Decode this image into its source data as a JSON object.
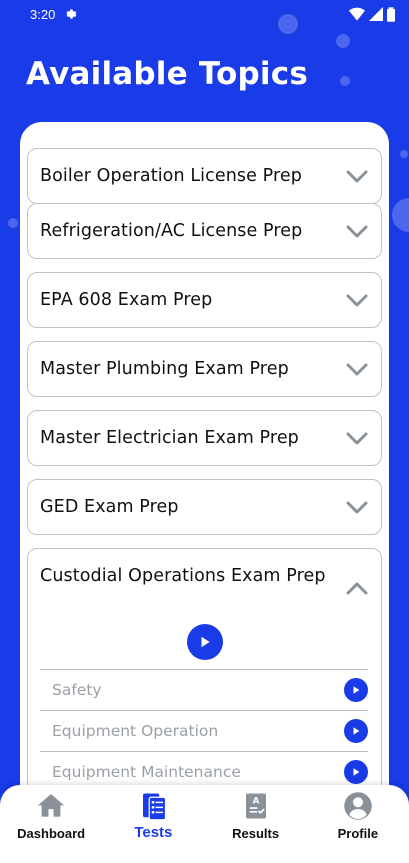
{
  "status_bar": {
    "time": "3:20"
  },
  "header": {
    "title": "Available Topics"
  },
  "topics": [
    {
      "label": "Boiler Operation License Prep",
      "expanded": false
    },
    {
      "label": "Refrigeration/AC License Prep",
      "expanded": false
    },
    {
      "label": "EPA 608 Exam Prep",
      "expanded": false
    },
    {
      "label": "Master Plumbing Exam Prep",
      "expanded": false
    },
    {
      "label": "Master Electrician Exam Prep",
      "expanded": false
    },
    {
      "label": "GED Exam Prep",
      "expanded": false
    },
    {
      "label": "Custodial Operations Exam Prep",
      "expanded": true,
      "subtopics": [
        "Safety",
        "Equipment Operation",
        "Equipment Maintenance"
      ]
    }
  ],
  "bottom_nav": {
    "items": [
      {
        "label": "Dashboard",
        "icon": "home-icon",
        "active": false
      },
      {
        "label": "Tests",
        "icon": "tests-icon",
        "active": true
      },
      {
        "label": "Results",
        "icon": "results-icon",
        "active": false
      },
      {
        "label": "Profile",
        "icon": "profile-icon",
        "active": false
      }
    ]
  },
  "colors": {
    "primary": "#1a3be8",
    "card_border": "#bfc3c9",
    "chevron": "#8a9199",
    "subtopic_text": "#9aa0a6"
  }
}
